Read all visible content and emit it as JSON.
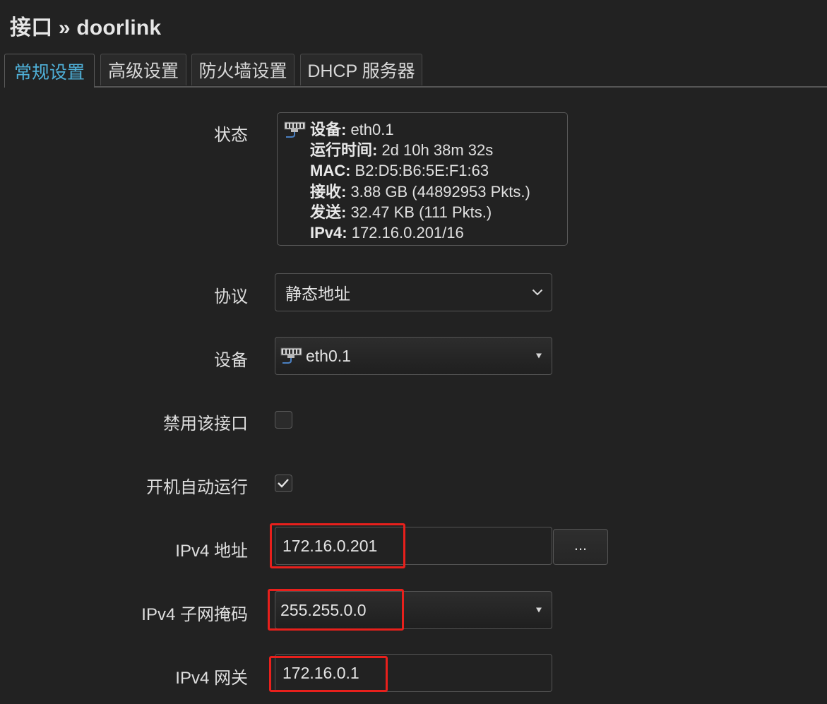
{
  "page": {
    "title": "接口 » doorlink"
  },
  "tabs": [
    {
      "label": "常规设置",
      "active": true
    },
    {
      "label": "高级设置",
      "active": false
    },
    {
      "label": "防火墙设置",
      "active": false
    },
    {
      "label": "DHCP 服务器",
      "active": false
    }
  ],
  "status": {
    "label": "状态",
    "lines": [
      {
        "key": "设备:",
        "value": " eth0.1"
      },
      {
        "key": "运行时间:",
        "value": " 2d 10h 38m 32s"
      },
      {
        "key": "MAC:",
        "value": " B2:D5:B6:5E:F1:63"
      },
      {
        "key": "接收:",
        "value": " 3.88 GB (44892953 Pkts.)"
      },
      {
        "key": "发送:",
        "value": " 32.47 KB (111 Pkts.)"
      },
      {
        "key": "IPv4:",
        "value": " 172.16.0.201/16"
      }
    ]
  },
  "protocol": {
    "label": "协议",
    "value": "静态地址"
  },
  "device": {
    "label": "设备",
    "value": "eth0.1",
    "icon": "network-port-icon"
  },
  "disable": {
    "label": "禁用该接口",
    "checked": false
  },
  "autostart": {
    "label": "开机自动运行",
    "checked": true
  },
  "ipv4_address": {
    "label": "IPv4 地址",
    "value": "172.16.0.201",
    "more_label": "..."
  },
  "ipv4_netmask": {
    "label": "IPv4 子网掩码",
    "value": "255.255.0.0"
  },
  "ipv4_gateway": {
    "label": "IPv4 网关",
    "value": "172.16.0.1"
  },
  "colors": {
    "background": "#222222",
    "active_tab": "#4fb0d8",
    "highlight": "#e8201c"
  }
}
